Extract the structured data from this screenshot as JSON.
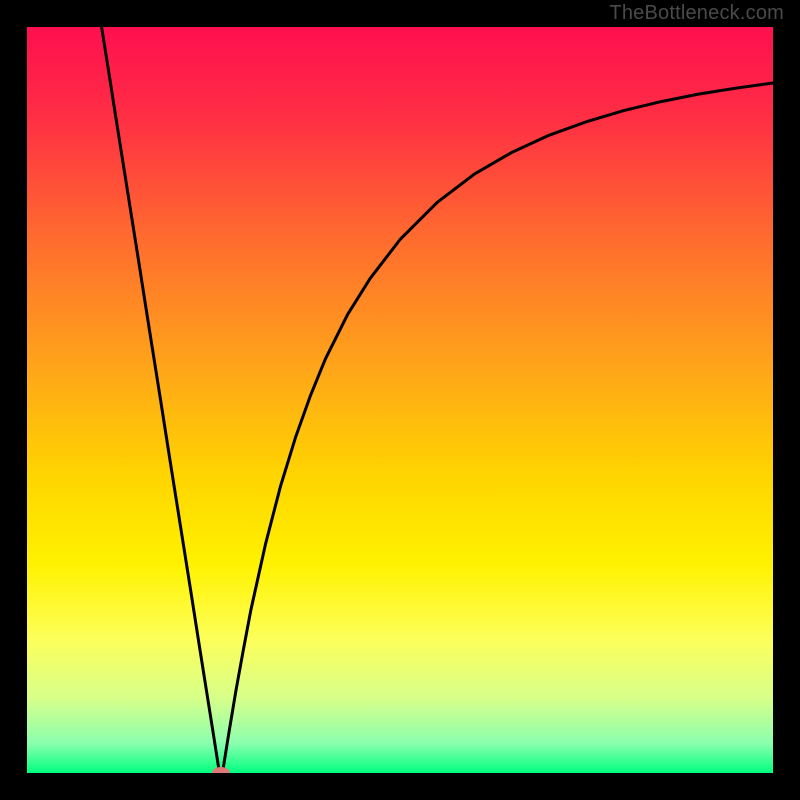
{
  "watermark": "TheBottleneck.com",
  "chart_data": {
    "type": "line",
    "title": "",
    "xlabel": "",
    "ylabel": "",
    "xlim": [
      0,
      100
    ],
    "ylim": [
      0,
      100
    ],
    "grid": false,
    "legend": false,
    "background_gradient_stops": [
      {
        "offset": 0.0,
        "color": "#ff0f4f"
      },
      {
        "offset": 0.12,
        "color": "#ff2e44"
      },
      {
        "offset": 0.28,
        "color": "#ff6a2f"
      },
      {
        "offset": 0.45,
        "color": "#ffa31a"
      },
      {
        "offset": 0.6,
        "color": "#ffd400"
      },
      {
        "offset": 0.72,
        "color": "#fff200"
      },
      {
        "offset": 0.82,
        "color": "#fdff5a"
      },
      {
        "offset": 0.9,
        "color": "#d7ff8a"
      },
      {
        "offset": 0.96,
        "color": "#8bffae"
      },
      {
        "offset": 1.0,
        "color": "#00ff7f"
      }
    ],
    "series": [
      {
        "name": "bottleneck-curve",
        "color": "#000000",
        "stroke_width": 3,
        "x": [
          10.0,
          11.0,
          12.0,
          13.0,
          14.0,
          15.0,
          16.0,
          17.0,
          18.0,
          19.0,
          20.0,
          21.0,
          22.0,
          23.0,
          24.0,
          25.0,
          25.8,
          26.2,
          27.0,
          28.0,
          29.0,
          30.0,
          32.0,
          34.0,
          36.0,
          38.0,
          40.0,
          43.0,
          46.0,
          50.0,
          55.0,
          60.0,
          65.0,
          70.0,
          75.0,
          80.0,
          85.0,
          90.0,
          95.0,
          100.0
        ],
        "y": [
          100.0,
          93.7,
          87.3,
          81.0,
          74.7,
          68.4,
          62.0,
          55.7,
          49.4,
          43.0,
          36.7,
          30.4,
          24.1,
          17.7,
          11.4,
          5.1,
          0.0,
          0.0,
          5.0,
          11.0,
          16.5,
          21.8,
          30.8,
          38.5,
          45.0,
          50.6,
          55.5,
          61.5,
          66.3,
          71.5,
          76.5,
          80.3,
          83.2,
          85.5,
          87.3,
          88.8,
          90.0,
          91.0,
          91.8,
          92.5
        ]
      }
    ],
    "marker": {
      "name": "optimal-point",
      "x": 26.0,
      "y": 0.0,
      "rx": 1.2,
      "ry": 0.8,
      "color": "#e07878"
    }
  }
}
